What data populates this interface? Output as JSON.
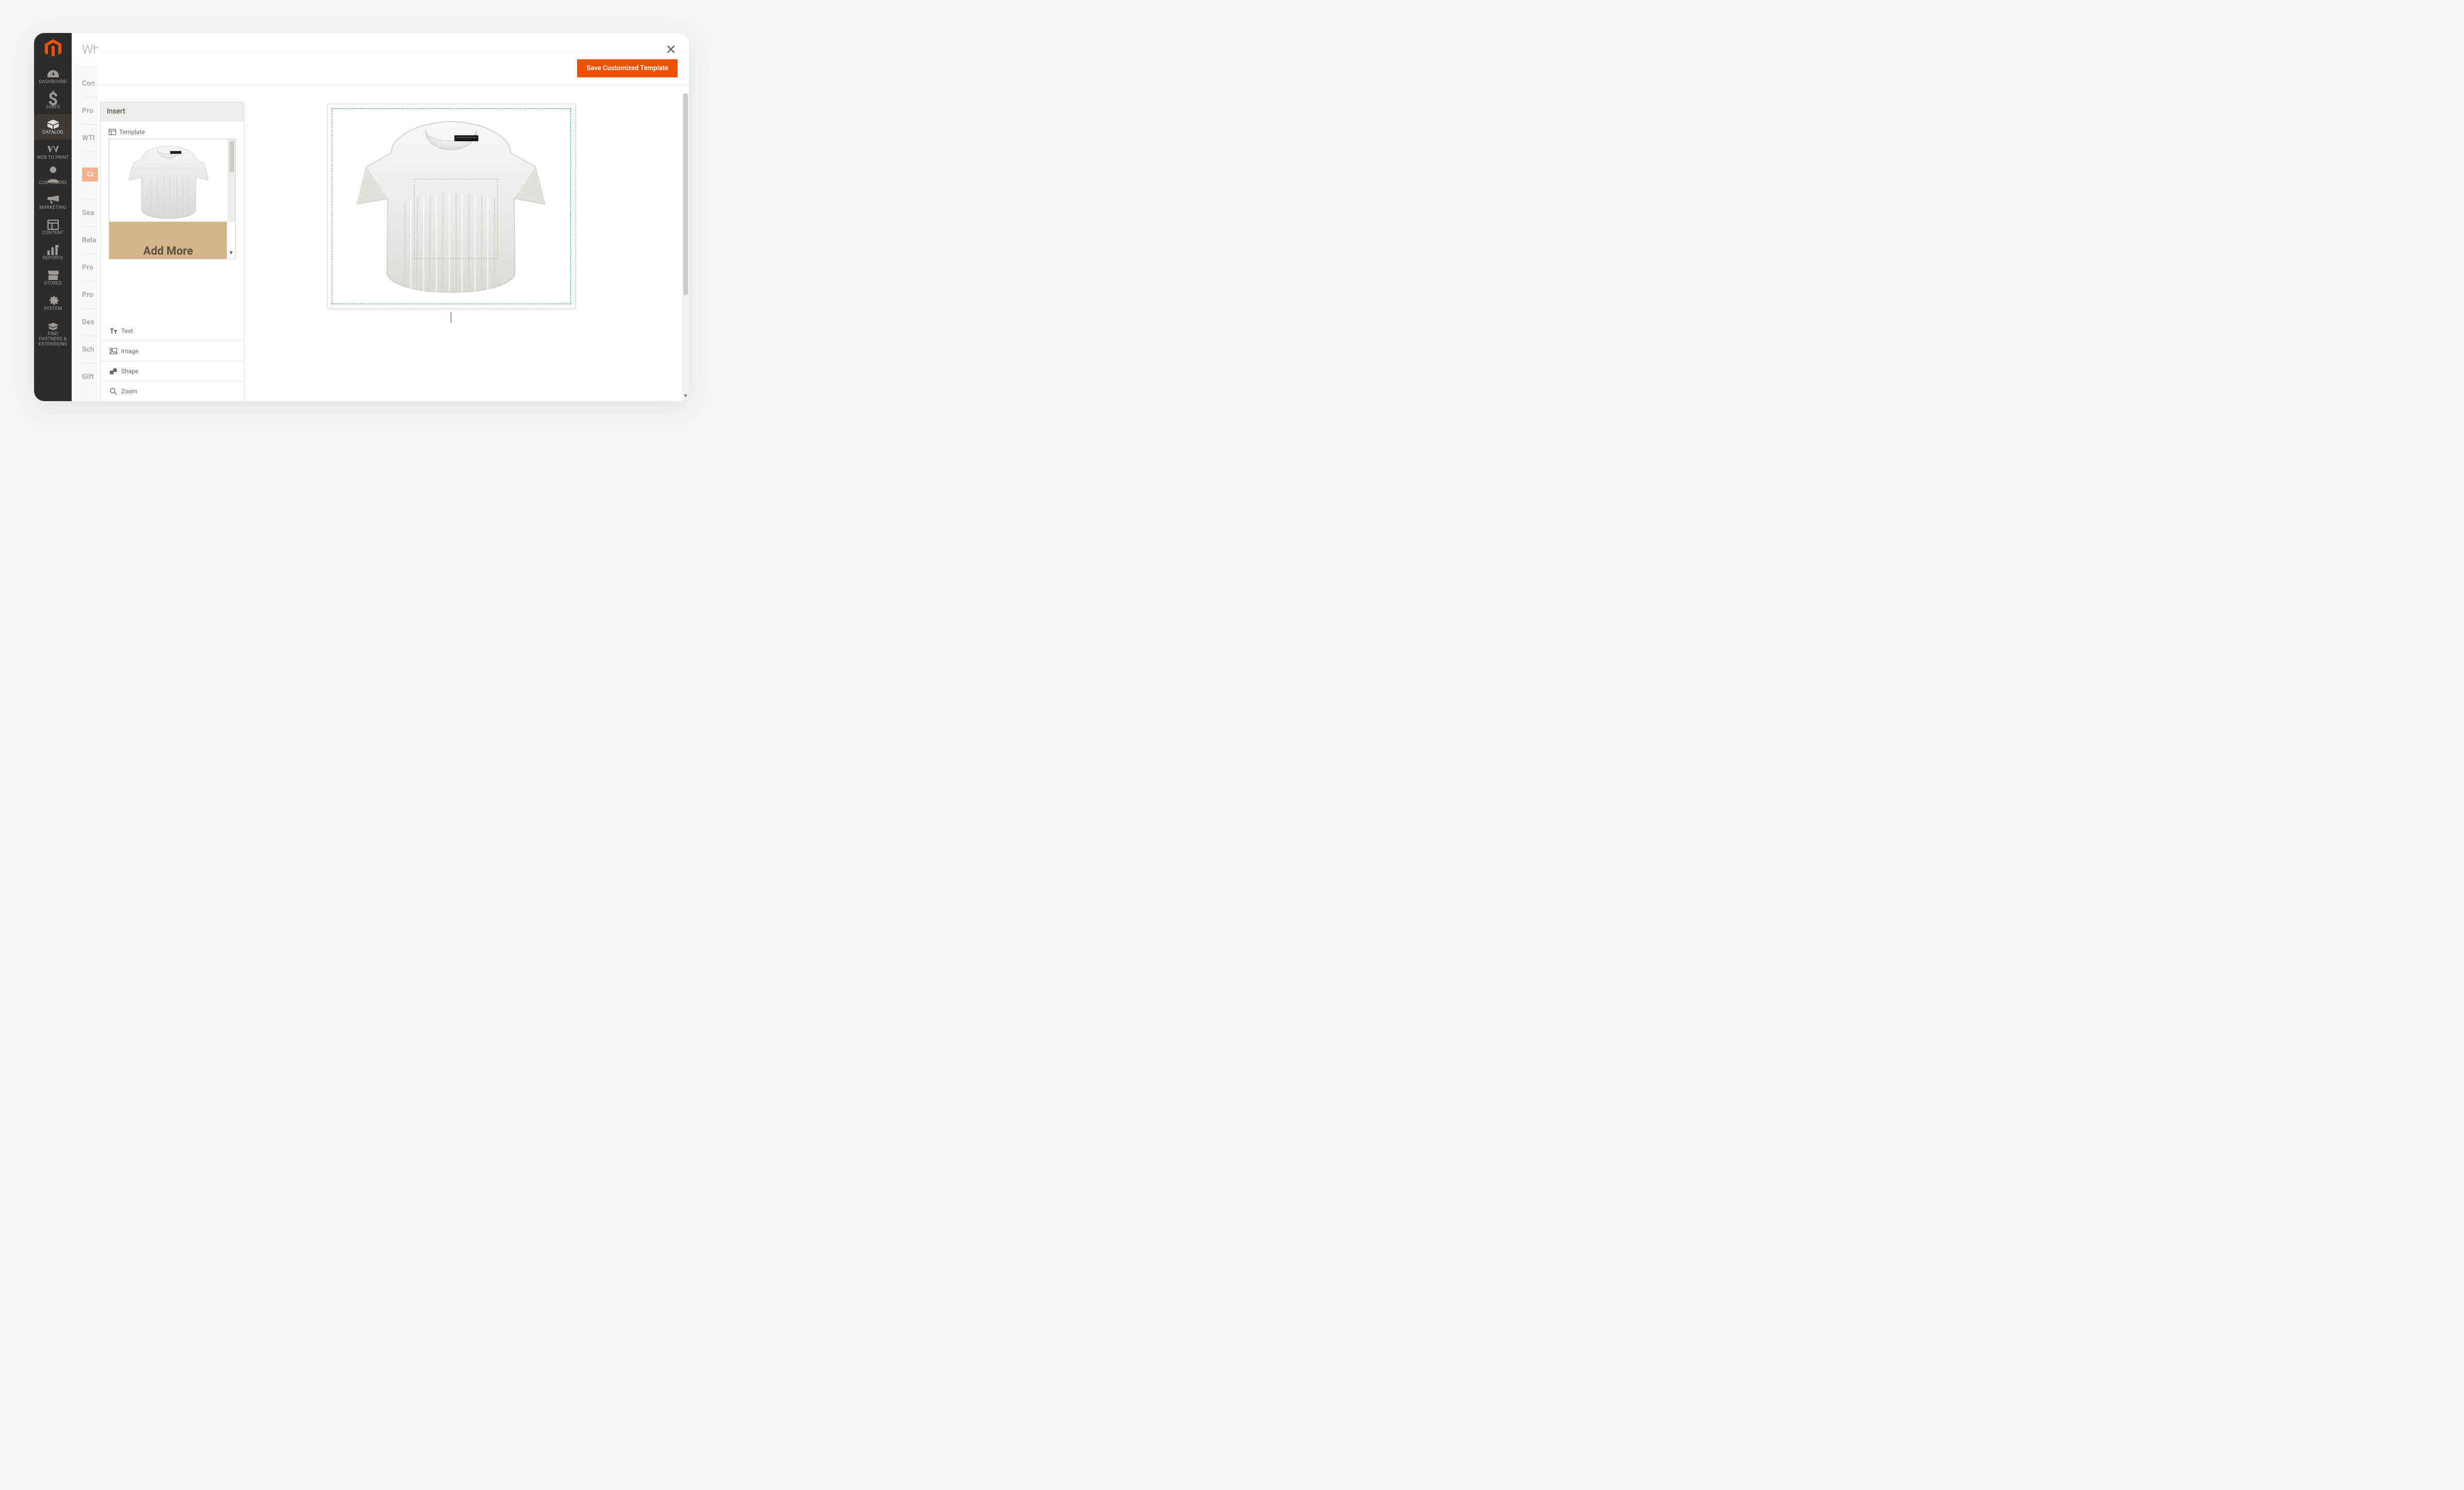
{
  "sidebar": {
    "items": [
      {
        "label": "DASHBOARD"
      },
      {
        "label": "SALES"
      },
      {
        "label": "CATALOG"
      },
      {
        "label": "WEB TO PRINT"
      },
      {
        "label": "CUSTOMERS"
      },
      {
        "label": "MARKETING"
      },
      {
        "label": "CONTENT"
      },
      {
        "label": "REPORTS"
      },
      {
        "label": "STORES"
      },
      {
        "label": "SYSTEM"
      },
      {
        "label": "FIND PARTNERS & EXTENSIONS"
      }
    ]
  },
  "page": {
    "title_partial": "Wh",
    "sections": [
      "Con",
      "Pro",
      "WTI",
      "Cr",
      "Sea",
      "Rela",
      "Pro",
      "Pro",
      "Des",
      "Sch",
      "Gift"
    ]
  },
  "modal": {
    "save_label": "Save Customized Template"
  },
  "insert": {
    "title": "Insert",
    "sections": {
      "template": "Template",
      "add_more": "Add More",
      "text": "Text",
      "image": "Image",
      "shape": "Shape",
      "zoom": "Zoom"
    }
  }
}
